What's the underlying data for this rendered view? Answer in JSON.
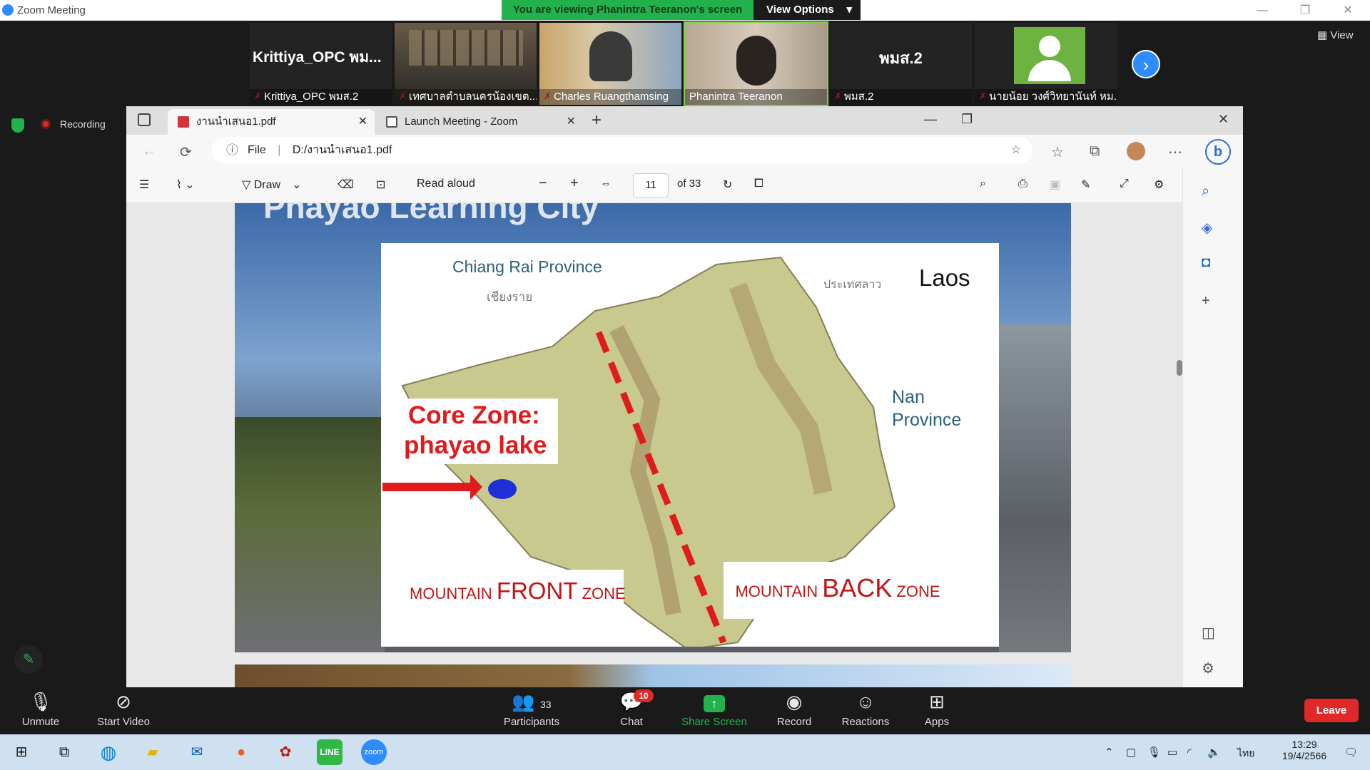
{
  "window": {
    "title": "Zoom Meeting",
    "minimize": "—",
    "restore": "❐",
    "close": "✕"
  },
  "banner": {
    "viewing_text": "You are viewing Phanintra Teeranon's screen",
    "view_options": "View Options",
    "view_options_caret": "▾"
  },
  "gallery": {
    "participants": [
      {
        "big": "Krittiya_OPC พม...",
        "name": "Krittiya_OPC พมส.2",
        "muted": true,
        "video": false
      },
      {
        "big": "",
        "name": "เทศบาลตำบลนครน้องเขต...",
        "muted": true,
        "video": true
      },
      {
        "big": "",
        "name": "Charles Ruangthamsing",
        "muted": true,
        "video": true
      },
      {
        "big": "",
        "name": "Phanintra Teeranon",
        "muted": false,
        "video": true,
        "active": true
      },
      {
        "big": "พมส.2",
        "name": "พมส.2",
        "muted": true,
        "video": false
      },
      {
        "big": "",
        "name": "นายน้อย วงศ์วิทยานันท์ หม...",
        "muted": true,
        "video": false
      }
    ],
    "next_icon": "›",
    "view_label": "View"
  },
  "recording": {
    "label": "Recording"
  },
  "browser": {
    "tabs": [
      {
        "label": "งานนำเสนอ1.pdf",
        "icon": "pdf-icon",
        "active": true
      },
      {
        "label": "Launch Meeting - Zoom",
        "icon": "page-icon",
        "active": false
      }
    ],
    "new_tab": "+",
    "url_prefix": "File",
    "url": "D:/งานนำเสนอ1.pdf"
  },
  "pdf_toolbar": {
    "draw_label": "Draw",
    "read_aloud_label": "Read aloud",
    "page_current": "11",
    "page_total": "of 33",
    "zoom_out": "−",
    "zoom_in": "+"
  },
  "slide": {
    "title": "Phayao Learning City",
    "map": {
      "chiang_rai": "Chiang Rai Province",
      "chiang_rai_thai": "เชียงราย",
      "laos_thai": "ประเทศลาว",
      "laos": "Laos",
      "nan": "Nan",
      "province": "Province",
      "core_zone": "Core Zone:",
      "core_zone_sub": "phayao lake",
      "front_a": "MOUNTAIN ",
      "front_b": "FRONT",
      "front_c": " ZONE",
      "back_a": "MOUNTAIN ",
      "back_b": "BACK",
      "back_c": " ZONE"
    }
  },
  "zoom_controls": {
    "unmute": "Unmute",
    "start_video": "Start Video",
    "participants": "Participants",
    "participants_count": "33",
    "chat": "Chat",
    "chat_badge": "10",
    "share_screen": "Share Screen",
    "record": "Record",
    "reactions": "Reactions",
    "apps": "Apps",
    "leave": "Leave"
  },
  "taskbar": {
    "lang": "ไทย",
    "time": "13:29",
    "date": "19/4/2566"
  },
  "colors": {
    "zoom_blue": "#2d8cff",
    "viewing_green": "#23b14d",
    "leave_red": "#e02828"
  }
}
